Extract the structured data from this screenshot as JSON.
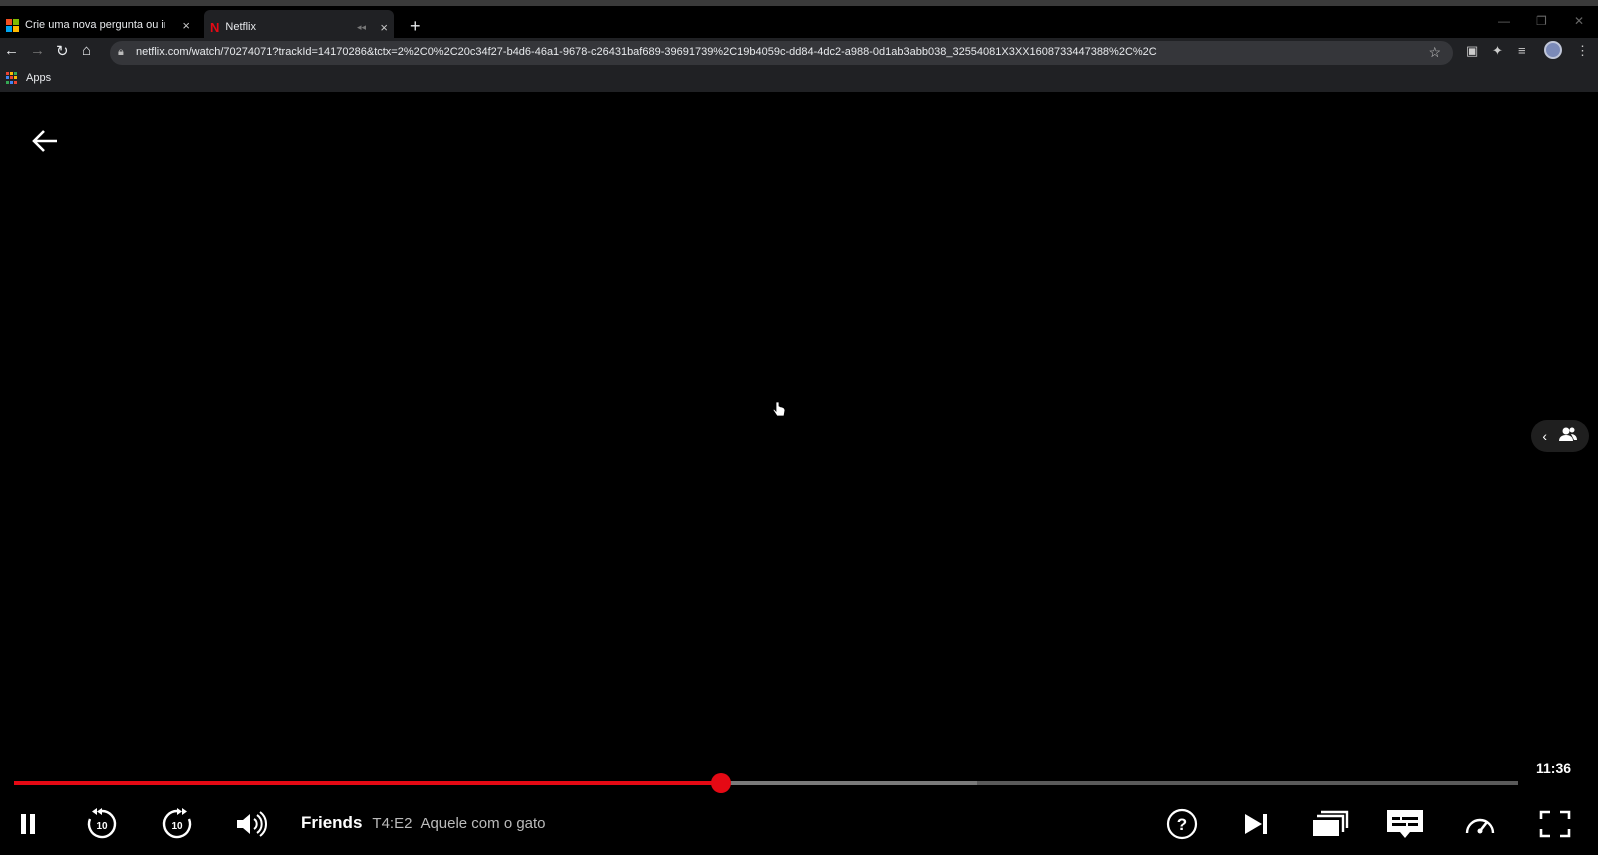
{
  "browser": {
    "tabs": [
      {
        "title": "Crie uma nova pergunta ou inicie",
        "close": "×"
      },
      {
        "title": "Netflix",
        "close": "×"
      }
    ],
    "new_tab": "+",
    "url": "netflix.com/watch/70274071?trackId=14170286&tctx=2%2C0%2C20c34f27-b4d6-46a1-9678-c26431baf689-39691739%2C19b4059c-dd84-4dc2-a988-0d1ab3abb038_32554081X3XX1608733447388%2C%2C",
    "bookmarks": {
      "apps_label": "Apps"
    }
  },
  "player": {
    "title": "Friends",
    "episode": "T4:E2",
    "episode_title": "Aquele com o gato",
    "time_remaining": "11:36",
    "progress": {
      "played_fraction": 0.47,
      "buffered_fraction": 0.64
    }
  },
  "colors": {
    "netflix_red": "#e50914",
    "chrome_dark": "#202124",
    "omnibox": "#35363a"
  }
}
